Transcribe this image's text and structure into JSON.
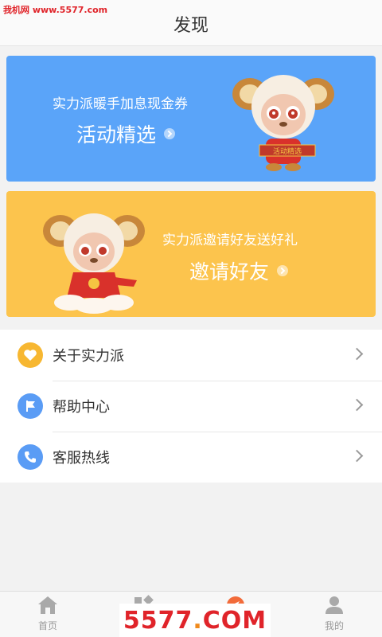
{
  "watermark_top": "我机网 www.5577.com",
  "header": {
    "title": "发现"
  },
  "banners": [
    {
      "subtitle": "实力派暖手加息现金券",
      "title": "活动精选",
      "scroll_text": "活动精选",
      "color": "#5aa4f9"
    },
    {
      "subtitle": "实力派邀请好友送好礼",
      "title": "邀请好友",
      "color": "#fcc44d"
    }
  ],
  "menu": [
    {
      "label": "关于实力派",
      "icon": "heart-icon",
      "icon_color": "#f7b731"
    },
    {
      "label": "帮助中心",
      "icon": "flag-icon",
      "icon_color": "#5a9cf5"
    },
    {
      "label": "客服热线",
      "icon": "phone-icon",
      "icon_color": "#5a9cf5"
    }
  ],
  "tabbar": {
    "items": [
      {
        "label": "首页",
        "icon": "home-icon"
      },
      {
        "label": "",
        "icon": "category-icon"
      },
      {
        "label": "",
        "icon": "compass-icon",
        "active": true
      },
      {
        "label": "我的",
        "icon": "user-icon"
      }
    ]
  },
  "watermark_bottom": {
    "main": "5577",
    "dot": ".",
    "suffix": "COM"
  }
}
